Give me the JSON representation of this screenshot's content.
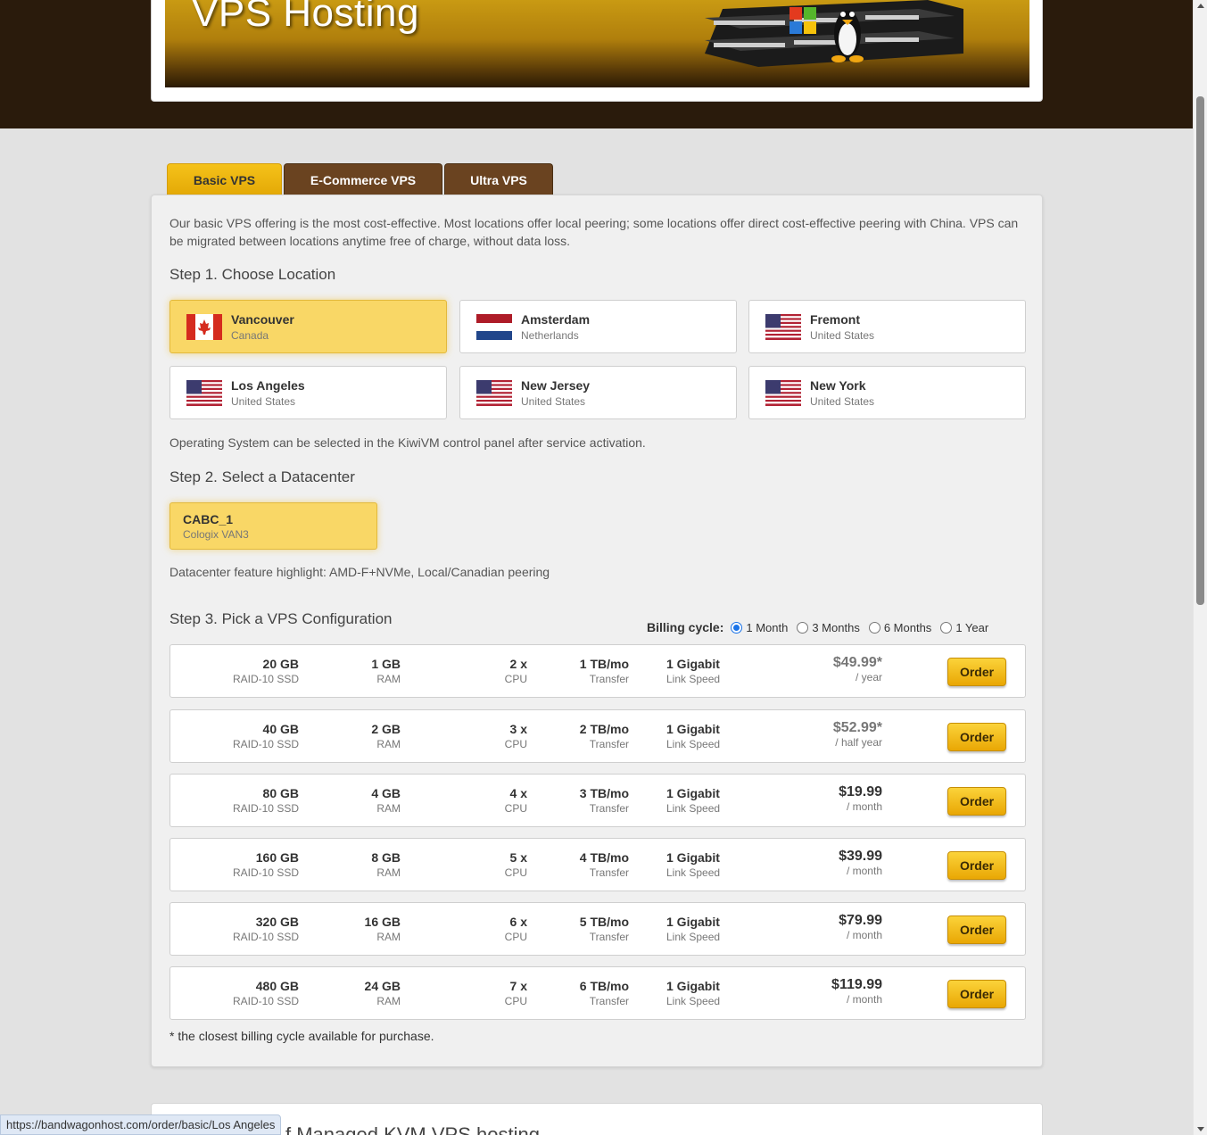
{
  "banner": {
    "title": "VPS Hosting"
  },
  "tabs": [
    {
      "label": "Basic VPS",
      "active": true
    },
    {
      "label": "E-Commerce VPS",
      "active": false
    },
    {
      "label": "Ultra VPS",
      "active": false
    }
  ],
  "intro": "Our basic VPS offering is the most cost-effective. Most locations offer local peering; some locations offer direct cost-effective peering with China. VPS can be migrated between locations anytime free of charge, without data loss.",
  "step1": {
    "heading": "Step 1. Choose Location",
    "locations": [
      {
        "name": "Vancouver",
        "country": "Canada",
        "flag": "canada-flag",
        "selected": true
      },
      {
        "name": "Amsterdam",
        "country": "Netherlands",
        "flag": "netherlands-flag",
        "selected": false
      },
      {
        "name": "Fremont",
        "country": "United States",
        "flag": "us-flag",
        "selected": false
      },
      {
        "name": "Los Angeles",
        "country": "United States",
        "flag": "us-flag",
        "selected": false
      },
      {
        "name": "New Jersey",
        "country": "United States",
        "flag": "us-flag",
        "selected": false
      },
      {
        "name": "New York",
        "country": "United States",
        "flag": "us-flag",
        "selected": false
      }
    ],
    "note": "Operating System can be selected in the KiwiVM control panel after service activation."
  },
  "step2": {
    "heading": "Step 2. Select a Datacenter",
    "datacenter": {
      "name": "CABC_1",
      "facility": "Cologix VAN3"
    },
    "highlight": "Datacenter feature highlight: AMD-F+NVMe, Local/Canadian peering"
  },
  "step3": {
    "heading": "Step 3. Pick a VPS Configuration",
    "billing": {
      "label": "Billing cycle:",
      "options": [
        "1 Month",
        "3 Months",
        "6 Months",
        "1 Year"
      ],
      "selected": "1 Month"
    },
    "plans": [
      {
        "disk": "20 GB",
        "disk_unit": "RAID-10 SSD",
        "ram": "1 GB",
        "ram_unit": "RAM",
        "cpu": "2 x",
        "cpu_unit": "CPU",
        "transfer": "1 TB/mo",
        "transfer_unit": "Transfer",
        "link": "1 Gigabit",
        "link_unit": "Link Speed",
        "price": "$49.99*",
        "period": "/ year",
        "muted": true,
        "order": "Order"
      },
      {
        "disk": "40 GB",
        "disk_unit": "RAID-10 SSD",
        "ram": "2 GB",
        "ram_unit": "RAM",
        "cpu": "3 x",
        "cpu_unit": "CPU",
        "transfer": "2 TB/mo",
        "transfer_unit": "Transfer",
        "link": "1 Gigabit",
        "link_unit": "Link Speed",
        "price": "$52.99*",
        "period": "/ half year",
        "muted": true,
        "order": "Order"
      },
      {
        "disk": "80 GB",
        "disk_unit": "RAID-10 SSD",
        "ram": "4 GB",
        "ram_unit": "RAM",
        "cpu": "4 x",
        "cpu_unit": "CPU",
        "transfer": "3 TB/mo",
        "transfer_unit": "Transfer",
        "link": "1 Gigabit",
        "link_unit": "Link Speed",
        "price": "$19.99",
        "period": "/ month",
        "muted": false,
        "order": "Order"
      },
      {
        "disk": "160 GB",
        "disk_unit": "RAID-10 SSD",
        "ram": "8 GB",
        "ram_unit": "RAM",
        "cpu": "5 x",
        "cpu_unit": "CPU",
        "transfer": "4 TB/mo",
        "transfer_unit": "Transfer",
        "link": "1 Gigabit",
        "link_unit": "Link Speed",
        "price": "$39.99",
        "period": "/ month",
        "muted": false,
        "order": "Order"
      },
      {
        "disk": "320 GB",
        "disk_unit": "RAID-10 SSD",
        "ram": "16 GB",
        "ram_unit": "RAM",
        "cpu": "6 x",
        "cpu_unit": "CPU",
        "transfer": "5 TB/mo",
        "transfer_unit": "Transfer",
        "link": "1 Gigabit",
        "link_unit": "Link Speed",
        "price": "$79.99",
        "period": "/ month",
        "muted": false,
        "order": "Order"
      },
      {
        "disk": "480 GB",
        "disk_unit": "RAID-10 SSD",
        "ram": "24 GB",
        "ram_unit": "RAM",
        "cpu": "7 x",
        "cpu_unit": "CPU",
        "transfer": "6 TB/mo",
        "transfer_unit": "Transfer",
        "link": "1 Gigabit",
        "link_unit": "Link Speed",
        "price": "$119.99",
        "period": "/ month",
        "muted": false,
        "order": "Order"
      }
    ],
    "footnote": "* the closest billing cycle available for purchase."
  },
  "next_section": {
    "title": "f Managed KVM VPS hosting"
  },
  "status_url": "https://bandwagonhost.com/order/basic/Los Angeles"
}
